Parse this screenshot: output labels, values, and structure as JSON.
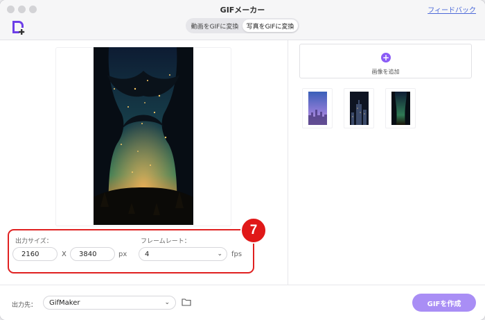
{
  "window": {
    "title": "GIFメーカー",
    "feedback_link": "フィードバック"
  },
  "mode_tabs": [
    {
      "label": "動画をGIFに変換",
      "active": false
    },
    {
      "label": "写真をGIFに変換",
      "active": true
    }
  ],
  "preview": {
    "image": "forest-night-fireflies"
  },
  "settings": {
    "step_number": "7",
    "output_size_label": "出力サイズ：",
    "width": "2160",
    "height": "3840",
    "separator": "X",
    "size_unit": "px",
    "frame_rate_label": "フレームレート：",
    "frame_rate_value": "4",
    "frame_rate_unit": "fps"
  },
  "right_panel": {
    "add_image_label": "画像を追加",
    "thumbnails": [
      {
        "name": "city-skyline-dusk"
      },
      {
        "name": "city-towers-night"
      },
      {
        "name": "forest-night-fireflies"
      }
    ]
  },
  "footer": {
    "output_label": "出力先：",
    "output_folder": "GifMaker",
    "create_button": "GIFを作成"
  },
  "colors": {
    "accent_purple": "#8b5cf6",
    "button_purple": "#a98ef5",
    "highlight_red": "#e01818",
    "link_blue": "#4a68d8"
  }
}
